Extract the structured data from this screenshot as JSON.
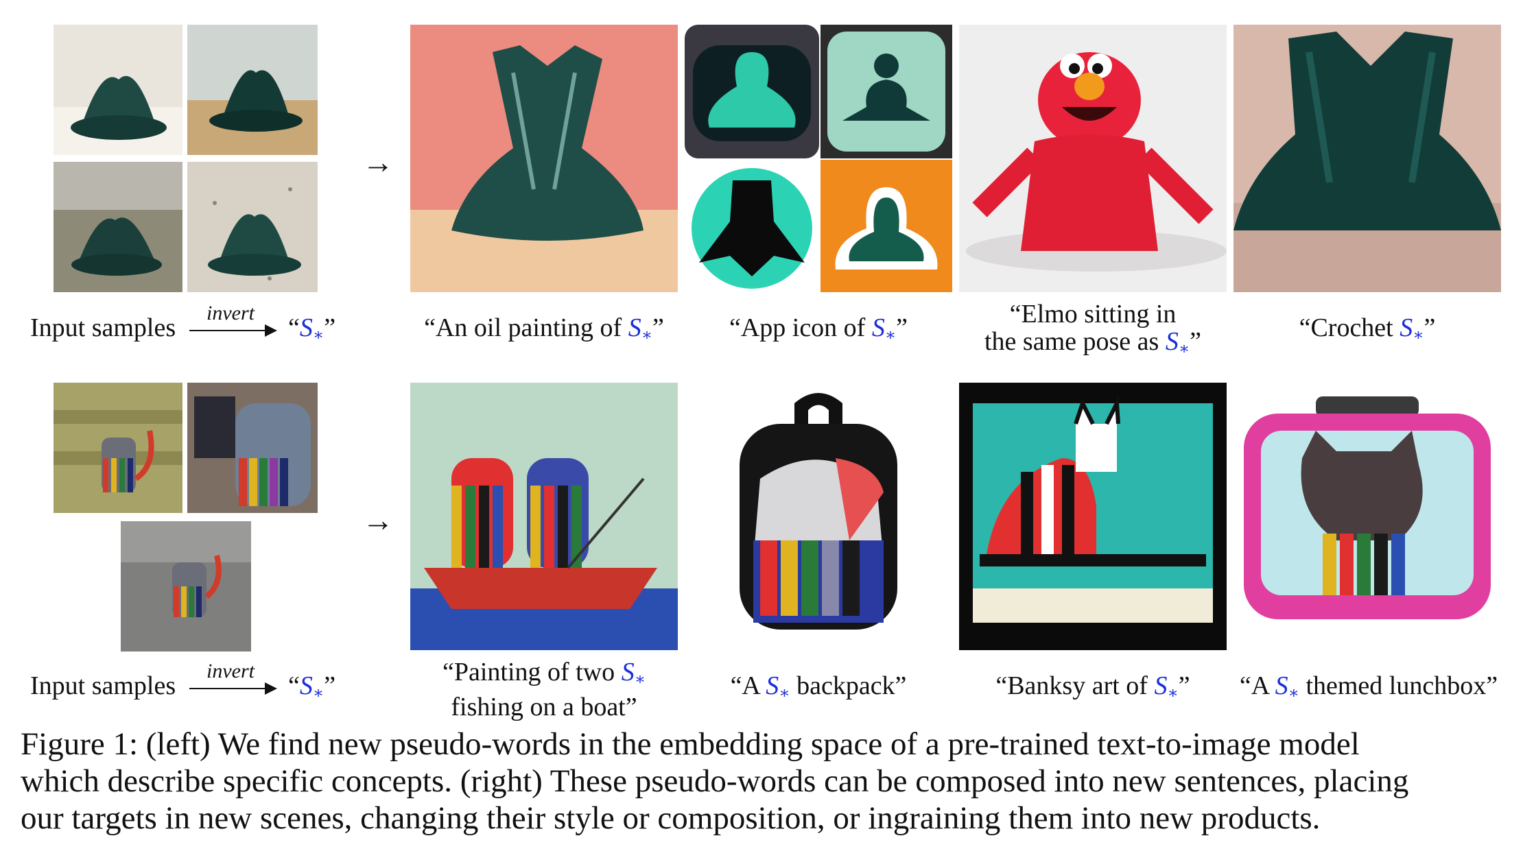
{
  "row1": {
    "input_label": "Input samples",
    "invert_label": "invert",
    "token_open": "“",
    "token": "S",
    "token_sub": "∗",
    "token_close": "”",
    "arrow": "→",
    "captions": [
      {
        "pre": "“An oil painting of ",
        "post": "”"
      },
      {
        "pre": "“App icon of ",
        "post": "”"
      },
      {
        "line1": "“Elmo sitting in",
        "pre": "the same pose as ",
        "post": "”"
      },
      {
        "pre": "“Crochet ",
        "post": "”"
      }
    ]
  },
  "row2": {
    "input_label": "Input samples",
    "invert_label": "invert",
    "token_open": "“",
    "token": "S",
    "token_sub": "∗",
    "token_close": "”",
    "arrow": "→",
    "captions": [
      {
        "pre": "“Painting of two ",
        "line2": "fishing on a boat”"
      },
      {
        "pre": "“A ",
        "post": " backpack”"
      },
      {
        "pre": "“Banksy art of ",
        "post": "”"
      },
      {
        "pre": "“A ",
        "post": " themed lunchbox”"
      }
    ]
  },
  "figure_caption": {
    "line1": "Figure 1: (left) We find new pseudo-words in the embedding space of a pre-trained text-to-image model",
    "line2": "which describe specific concepts. (right) These pseudo-words can be composed into new sentences, placing",
    "line3": "our targets in new scenes, changing their style or composition, or ingraining them into new products."
  },
  "colors": {
    "token": "#1a2fd6",
    "text": "#111111",
    "background": "#ffffff"
  }
}
